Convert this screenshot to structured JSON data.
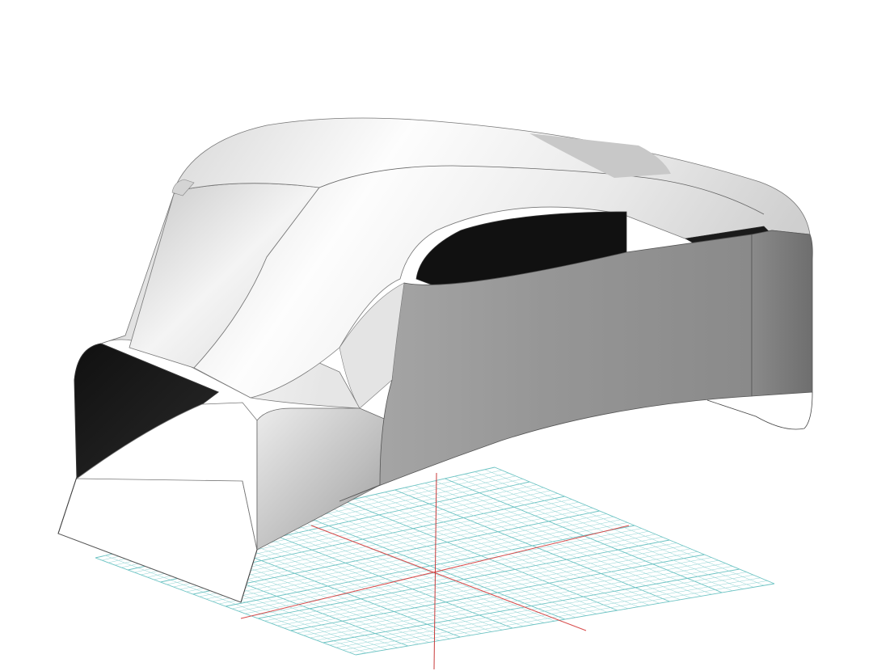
{
  "viewport": {
    "background": "#ffffff",
    "view_mode": "perspective",
    "shading": "shaded"
  },
  "construction_plane": {
    "grid_color": "#8fd3d3",
    "major_grid_color": "#6cc3c3",
    "x_axis_color": "#d84a4a",
    "y_axis_color": "#d84a4a",
    "z_axis_color": "#c83a3a"
  },
  "model": {
    "object": "car-body-surface",
    "light_surface": "#f2f2f2",
    "mid_surface": "#bdbdbd",
    "side_panel": "#9c9c9c",
    "dark_opening": "#111111",
    "edge_color": "#555555"
  }
}
